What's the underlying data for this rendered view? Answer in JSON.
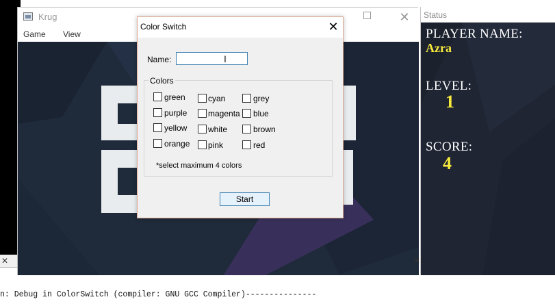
{
  "game_window": {
    "title": "Krug",
    "menu": [
      "Game",
      "View"
    ]
  },
  "status_window": {
    "title": "Status",
    "player_name_label": "PLAYER NAME:",
    "player_name": "Azra",
    "level_label": "LEVEL:",
    "level": "1",
    "score_label": "SCORE:",
    "score": "4"
  },
  "dialog": {
    "title": "Color Switch",
    "name_label": "Name:",
    "name_value": "",
    "colors_legend": "Colors",
    "colors": [
      [
        "green",
        "cyan",
        "grey"
      ],
      [
        "purple",
        "magenta",
        "blue"
      ],
      [
        "yellow",
        "white",
        "brown"
      ],
      [
        "orange",
        "pink",
        "red"
      ]
    ],
    "hint": "*select maximum 4 colors",
    "start_label": "Start"
  },
  "log": {
    "line": "n: Debug in ColorSwitch (compiler: GNU GCC Compiler)---------------"
  },
  "colors": {
    "game_background": "#1f2a3a",
    "status_background": "#1f2533",
    "status_value": "#f7ea3c",
    "dialog_border": "#e0a890",
    "input_border": "#3c7fb1"
  }
}
